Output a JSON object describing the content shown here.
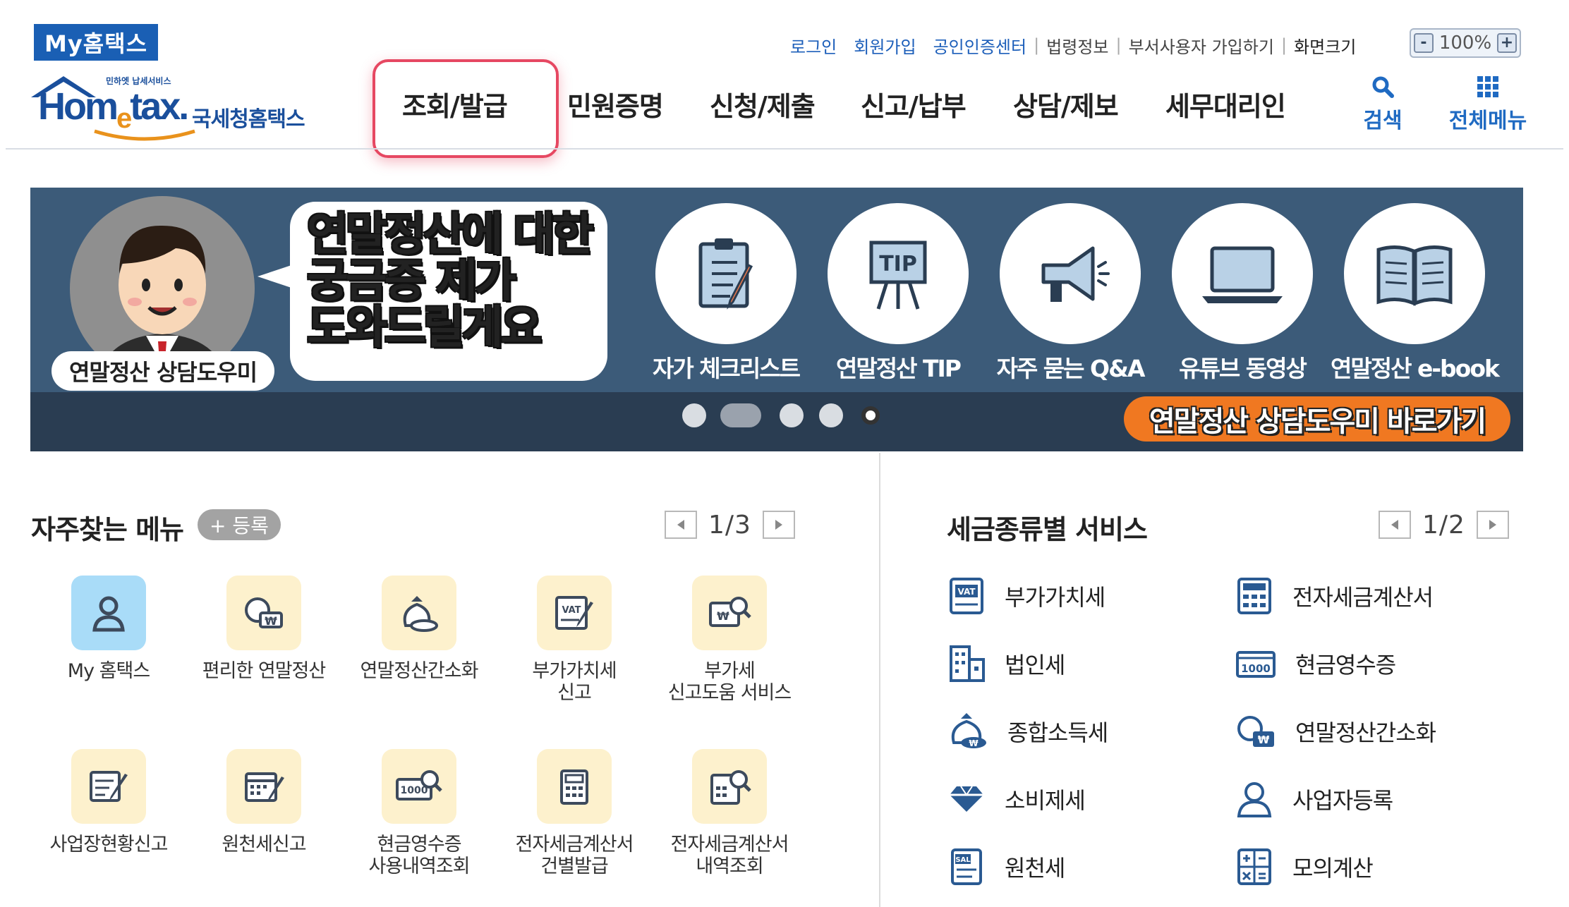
{
  "header": {
    "my_hometax": "My홈택스",
    "logo": {
      "tiny": "민하엣 납세서비스",
      "brand_main": "Hom",
      "brand_e": "e",
      "brand_tail": "tax.",
      "brand_kr": "국세청홈택스"
    },
    "util_links": [
      "로그인",
      "회원가입",
      "공인인증센터"
    ],
    "util_plain": [
      "법령정보",
      "부서사용자 가입하기"
    ],
    "screen_size_label": "화면크기",
    "zoom": {
      "minus": "-",
      "value": "100%",
      "plus": "+"
    },
    "nav": [
      {
        "label": "조회/발급",
        "selected": true
      },
      {
        "label": "민원증명"
      },
      {
        "label": "신청/제출"
      },
      {
        "label": "신고/납부"
      },
      {
        "label": "상담/제보"
      },
      {
        "label": "세무대리인"
      }
    ],
    "search": {
      "label": "검색",
      "icon": "search-icon"
    },
    "all_menu": {
      "label": "전체메뉴",
      "icon": "grid-icon"
    }
  },
  "banner": {
    "avatar_label": "연말정산 상담도우미",
    "bubble_lines": [
      "연말정산에 대한",
      "궁금증 제가",
      "도와드릴게요"
    ],
    "items": [
      {
        "label": "자가 체크리스트",
        "icon": "clipboard-checklist-icon"
      },
      {
        "label": "연말정산 TIP",
        "icon": "tip-easel-icon"
      },
      {
        "label": "자주 묻는 Q&A",
        "icon": "megaphone-icon"
      },
      {
        "label": "유튜브 동영상",
        "icon": "laptop-icon"
      },
      {
        "label": "연말정산 e-book",
        "icon": "open-book-icon"
      }
    ],
    "tip_text": "TIP",
    "cta": "연말정산 상담도우미 바로가기",
    "slide_count": 5,
    "active_slide": 2
  },
  "frequent_menu": {
    "title": "자주찾는 메뉴",
    "register": "+ 등록",
    "page": "1/3",
    "items": [
      {
        "label": "My 홈택스",
        "icon": "person-icon",
        "highlight": true
      },
      {
        "label": "편리한 연말정산",
        "icon": "coin-won-icon"
      },
      {
        "label": "연말정산간소화",
        "icon": "money-bag-icon"
      },
      {
        "label": "부가가치세 신고",
        "icon": "vat-doc-icon"
      },
      {
        "label": "부가세 신고도움 서비스",
        "icon": "won-search-icon"
      },
      {
        "label": "사업장현황신고",
        "icon": "doc-edit-icon"
      },
      {
        "label": "원천세신고",
        "icon": "calendar-edit-icon"
      },
      {
        "label": "현금영수증 사용내역조회",
        "icon": "receipt-search-icon"
      },
      {
        "label": "전자세금계산서 건별발급",
        "icon": "calculator-icon"
      },
      {
        "label": "전자세금계산서 내역조회",
        "icon": "invoice-search-icon"
      }
    ],
    "labels_split": [
      [
        "My 홈택스"
      ],
      [
        "편리한 연말정산"
      ],
      [
        "연말정산간소화"
      ],
      [
        "부가가치세",
        "신고"
      ],
      [
        "부가세",
        "신고도움 서비스"
      ],
      [
        "사업장현황신고"
      ],
      [
        "원천세신고"
      ],
      [
        "현금영수증",
        "사용내역조회"
      ],
      [
        "전자세금계산서",
        "건별발급"
      ],
      [
        "전자세금계산서",
        "내역조회"
      ]
    ],
    "icon_texts": {
      "vat": "VAT",
      "won": "₩",
      "cash": "1000"
    }
  },
  "tax_services": {
    "title": "세금종류별 서비스",
    "page": "1/2",
    "left": [
      {
        "label": "부가가치세",
        "icon": "vat-icon"
      },
      {
        "label": "법인세",
        "icon": "building-icon"
      },
      {
        "label": "종합소득세",
        "icon": "money-bag-icon"
      },
      {
        "label": "소비제세",
        "icon": "diamond-icon"
      },
      {
        "label": "원천세",
        "icon": "sal-doc-icon"
      }
    ],
    "right": [
      {
        "label": "전자세금계산서",
        "icon": "calculator-doc-icon"
      },
      {
        "label": "현금영수증",
        "icon": "cash-bill-icon"
      },
      {
        "label": "연말정산간소화",
        "icon": "coin-won-icon"
      },
      {
        "label": "사업자등록",
        "icon": "person-icon"
      },
      {
        "label": "모의계산",
        "icon": "calculator-icon"
      }
    ],
    "icon_texts": {
      "vat": "VAT",
      "sal": "SAL",
      "cash": "1000",
      "won": "₩"
    }
  },
  "colors": {
    "brand_blue": "#1a5fb4",
    "banner_bg": "#3c5b79",
    "highlight": "#e64862",
    "cta": "#f07821",
    "icon_bg": "#fdf1cd"
  }
}
